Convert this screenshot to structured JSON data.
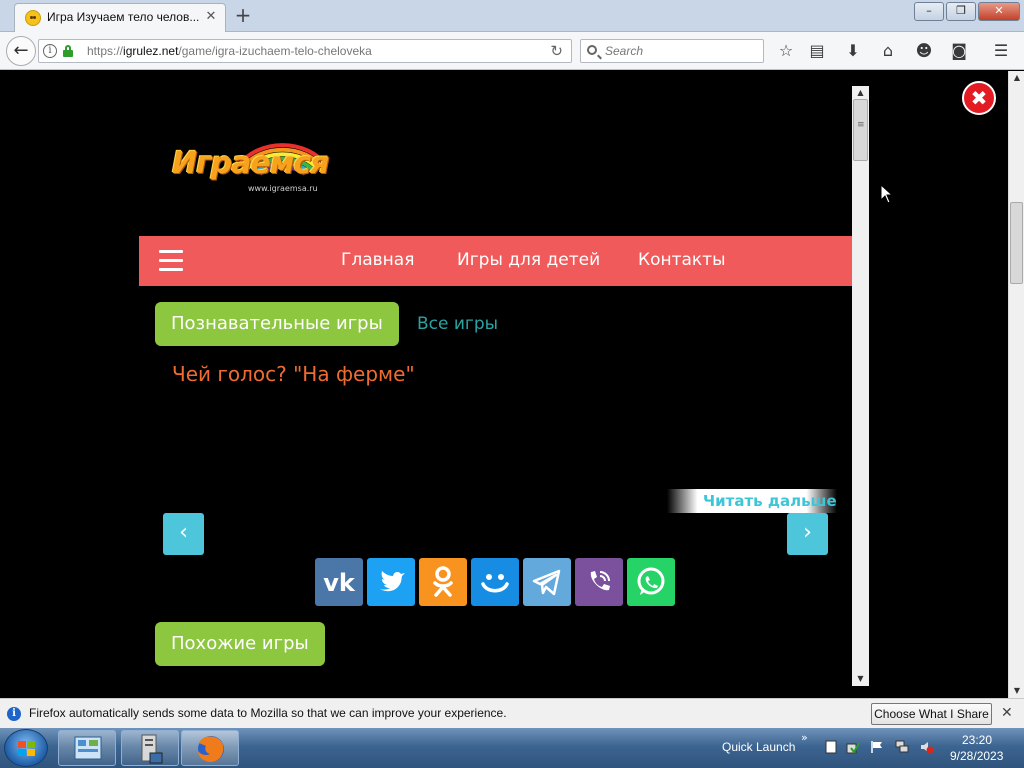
{
  "browser": {
    "tab_title": "Игра Изучаем тело челов...",
    "new_tab_symbol": "+",
    "url_prefix": "https://",
    "url_host": "igrulez.net",
    "url_path": "/game/igra-izuchaem-telo-cheloveka",
    "search_placeholder": "Search",
    "window_buttons": [
      "–",
      "❐",
      "✕"
    ]
  },
  "site": {
    "logo_text": "Играемся",
    "logo_subtext": "www.igraemsa.ru",
    "menu": [
      "Главная",
      "Игры для детей",
      "Контакты"
    ],
    "category_button": "Познавательные игры",
    "all_games_link": "Все игры",
    "game_title": "Чей голос? \"На ферме\"",
    "read_more": "Читать дальше",
    "prev_symbol": "‹",
    "next_symbol": "›",
    "similar_games_button": "Похожие игры",
    "social_buttons": [
      {
        "name": "vk",
        "color": "#4a76a8"
      },
      {
        "name": "twitter",
        "color": "#1da1f2"
      },
      {
        "name": "odnoklassniki",
        "color": "#f7931e"
      },
      {
        "name": "moimir",
        "color": "#168de2"
      },
      {
        "name": "telegram",
        "color": "#64a9dc"
      },
      {
        "name": "viber",
        "color": "#7b519d"
      },
      {
        "name": "whatsapp",
        "color": "#25d366"
      }
    ],
    "colors": {
      "menu_bg": "#f05a5a",
      "green": "#8dc63f",
      "teal": "#4dc6dc",
      "title_orange": "#ef6b2f"
    }
  },
  "notification": {
    "text": "Firefox automatically sends some data to Mozilla so that we can improve your experience.",
    "button": "Choose What I Share"
  },
  "taskbar": {
    "quick_launch": "Quick Launch",
    "time": "23:20",
    "date": "9/28/2023"
  }
}
